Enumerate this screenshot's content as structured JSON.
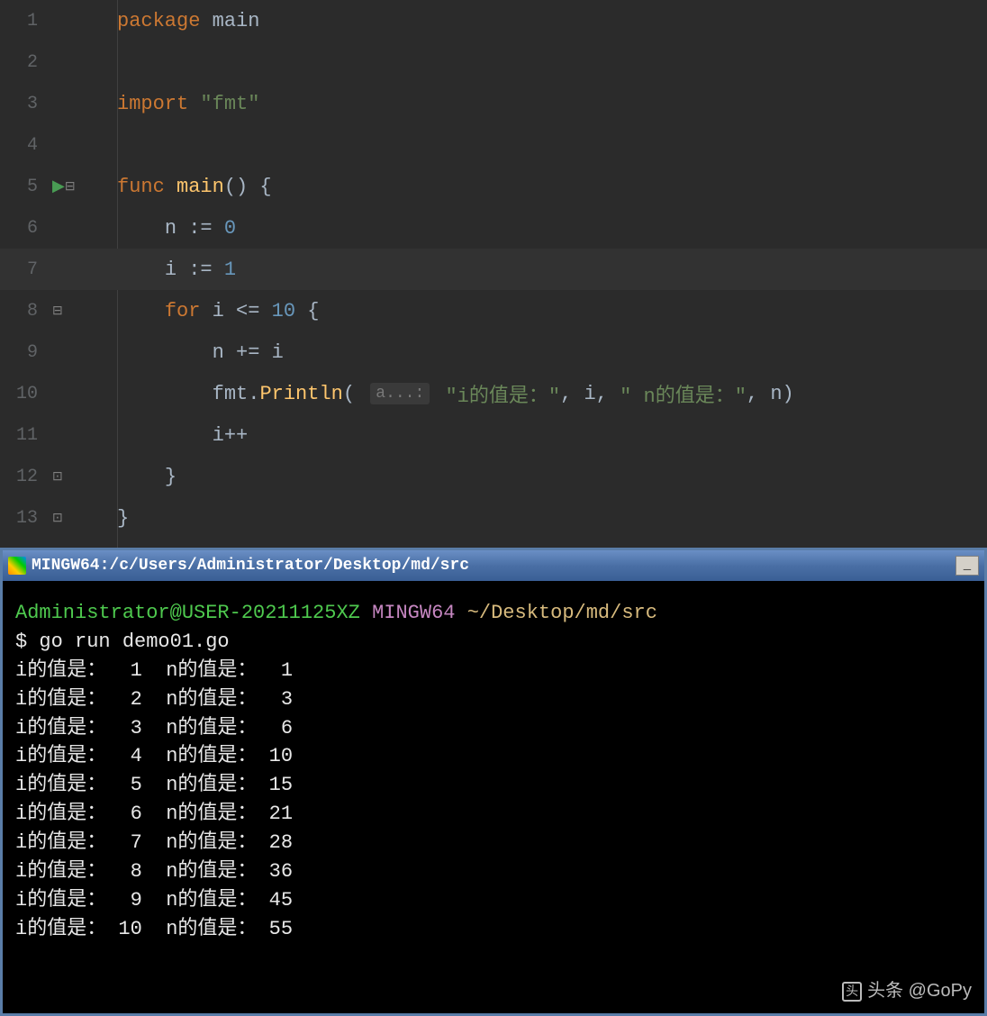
{
  "editor": {
    "lines": [
      {
        "n": 1,
        "tokens": [
          [
            "kw",
            "package"
          ],
          [
            "ident",
            " main"
          ]
        ]
      },
      {
        "n": 2,
        "tokens": []
      },
      {
        "n": 3,
        "tokens": [
          [
            "kw",
            "import"
          ],
          [
            "ident",
            " "
          ],
          [
            "str",
            "\"fmt\""
          ]
        ]
      },
      {
        "n": 4,
        "tokens": []
      },
      {
        "n": 5,
        "run": true,
        "fold": "open",
        "tokens": [
          [
            "kw",
            "func"
          ],
          [
            "ident",
            " "
          ],
          [
            "fn",
            "main"
          ],
          [
            "punct",
            "() {"
          ]
        ]
      },
      {
        "n": 6,
        "indent": 1,
        "tokens": [
          [
            "ident",
            "n "
          ],
          [
            "punct",
            ":= "
          ],
          [
            "num",
            "0"
          ]
        ]
      },
      {
        "n": 7,
        "indent": 1,
        "current": true,
        "tokens": [
          [
            "ident",
            "i "
          ],
          [
            "punct",
            ":= "
          ],
          [
            "num",
            "1"
          ]
        ]
      },
      {
        "n": 8,
        "indent": 1,
        "fold": "open",
        "tokens": [
          [
            "kw",
            "for"
          ],
          [
            "ident",
            " i "
          ],
          [
            "punct",
            "<= "
          ],
          [
            "num",
            "10"
          ],
          [
            "punct",
            " {"
          ]
        ]
      },
      {
        "n": 9,
        "indent": 2,
        "tokens": [
          [
            "ident",
            "n "
          ],
          [
            "punct",
            "+= "
          ],
          [
            "ident",
            "i"
          ]
        ]
      },
      {
        "n": 10,
        "indent": 2,
        "tokens": [
          [
            "ident",
            "fmt"
          ],
          [
            "punct",
            "."
          ],
          [
            "fn",
            "Println"
          ],
          [
            "punct",
            "( "
          ],
          [
            "hint",
            "a...:"
          ],
          [
            "ident",
            " "
          ],
          [
            "str",
            "\"i的值是：\""
          ],
          [
            "punct",
            ", "
          ],
          [
            "ident",
            "i"
          ],
          [
            "punct",
            ", "
          ],
          [
            "str",
            "\" n的值是：\""
          ],
          [
            "punct",
            ", "
          ],
          [
            "ident",
            "n"
          ],
          [
            "punct",
            ")"
          ]
        ]
      },
      {
        "n": 11,
        "indent": 2,
        "tokens": [
          [
            "ident",
            "i"
          ],
          [
            "punct",
            "++"
          ]
        ]
      },
      {
        "n": 12,
        "indent": 1,
        "fold": "close",
        "tokens": [
          [
            "punct",
            "}"
          ]
        ]
      },
      {
        "n": 13,
        "fold": "close",
        "tokens": [
          [
            "punct",
            "}"
          ]
        ]
      }
    ]
  },
  "terminal": {
    "title": "MINGW64:/c/Users/Administrator/Desktop/md/src",
    "prompt": {
      "user": "Administrator@USER-20211125XZ",
      "env": "MINGW64",
      "path": "~/Desktop/md/src"
    },
    "command": "$ go run demo01.go",
    "output_label_i": "i的值是：",
    "output_label_n": "n的值是：",
    "output": [
      {
        "i": 1,
        "n": 1
      },
      {
        "i": 2,
        "n": 3
      },
      {
        "i": 3,
        "n": 6
      },
      {
        "i": 4,
        "n": 10
      },
      {
        "i": 5,
        "n": 15
      },
      {
        "i": 6,
        "n": 21
      },
      {
        "i": 7,
        "n": 28
      },
      {
        "i": 8,
        "n": 36
      },
      {
        "i": 9,
        "n": 45
      },
      {
        "i": 10,
        "n": 55
      }
    ]
  },
  "watermark": "头条 @GoPy"
}
